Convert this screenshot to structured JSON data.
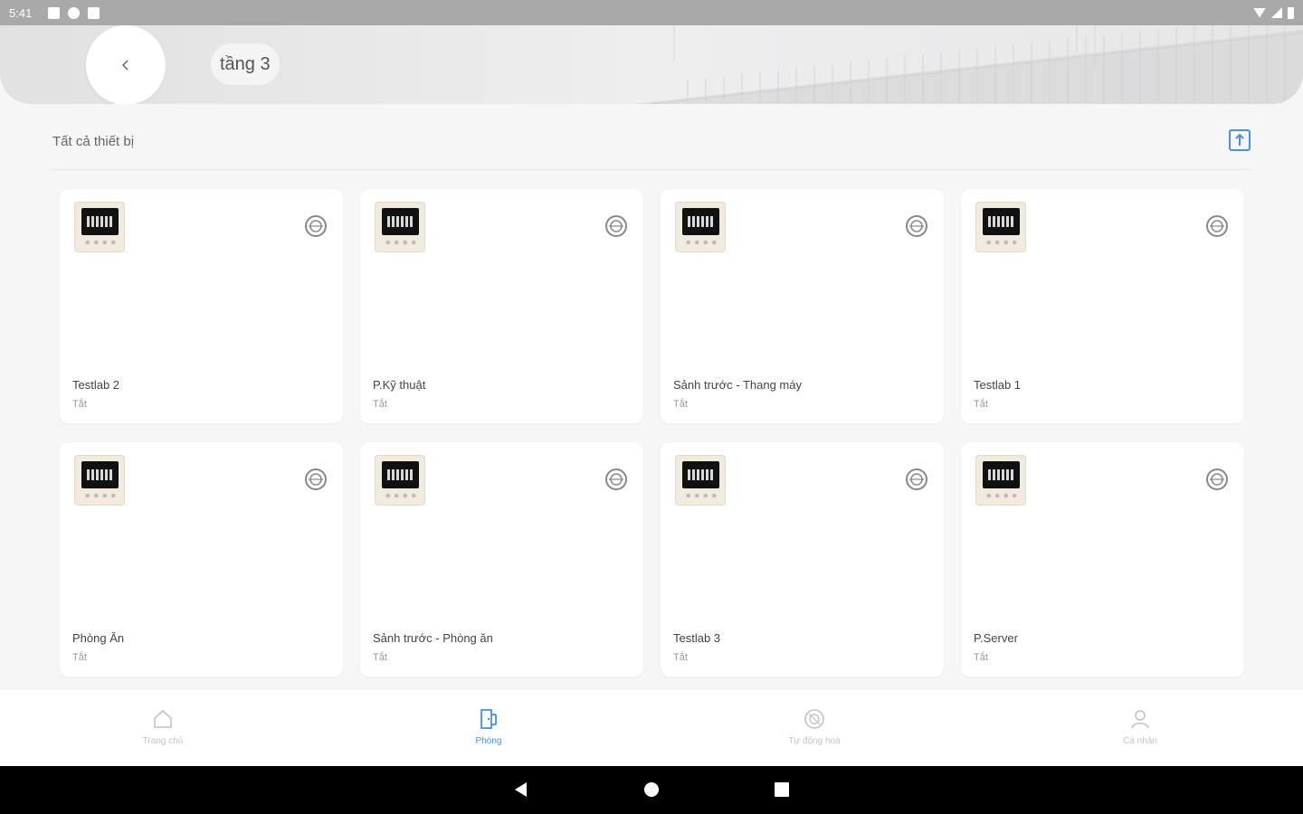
{
  "status_bar": {
    "time": "5:41"
  },
  "header": {
    "title": "tầng 3"
  },
  "section": {
    "title": "Tất cả thiết bị"
  },
  "devices": [
    {
      "name": "Testlab 2",
      "state": "Tắt"
    },
    {
      "name": "P.Kỹ thuật",
      "state": "Tắt"
    },
    {
      "name": "Sảnh trước - Thang máy",
      "state": "Tắt"
    },
    {
      "name": "Testlab 1",
      "state": "Tắt"
    },
    {
      "name": "Phòng Ăn",
      "state": "Tắt"
    },
    {
      "name": "Sảnh trước - Phòng ăn",
      "state": "Tắt"
    },
    {
      "name": "Testlab 3",
      "state": "Tắt"
    },
    {
      "name": "P.Server",
      "state": "Tắt"
    }
  ],
  "bottom_nav": [
    {
      "label": "Trang chủ",
      "icon": "home-icon",
      "active": false
    },
    {
      "label": "Phòng",
      "icon": "door-icon",
      "active": true
    },
    {
      "label": "Tự động hoá",
      "icon": "automation-icon",
      "active": false
    },
    {
      "label": "Cá nhân",
      "icon": "person-icon",
      "active": false
    }
  ],
  "colors": {
    "accent": "#4a90e2",
    "inactive": "#c3c3c3"
  }
}
